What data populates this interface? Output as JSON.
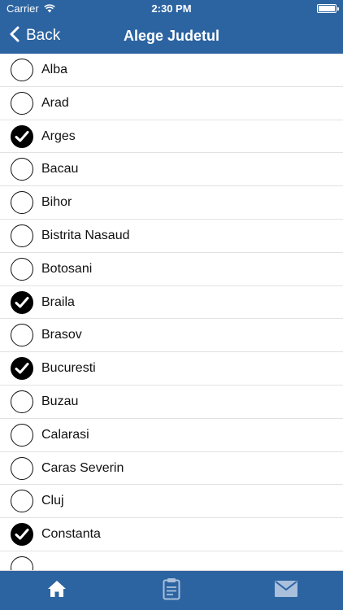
{
  "status_bar": {
    "carrier": "Carrier",
    "time": "2:30 PM"
  },
  "nav": {
    "back_label": "Back",
    "title": "Alege Judetul"
  },
  "counties": [
    {
      "label": "Alba",
      "checked": false
    },
    {
      "label": "Arad",
      "checked": false
    },
    {
      "label": "Arges",
      "checked": true
    },
    {
      "label": "Bacau",
      "checked": false
    },
    {
      "label": "Bihor",
      "checked": false
    },
    {
      "label": "Bistrita Nasaud",
      "checked": false
    },
    {
      "label": "Botosani",
      "checked": false
    },
    {
      "label": "Braila",
      "checked": true
    },
    {
      "label": "Brasov",
      "checked": false
    },
    {
      "label": "Bucuresti",
      "checked": true
    },
    {
      "label": "Buzau",
      "checked": false
    },
    {
      "label": "Calarasi",
      "checked": false
    },
    {
      "label": "Caras Severin",
      "checked": false
    },
    {
      "label": "Cluj",
      "checked": false
    },
    {
      "label": "Constanta",
      "checked": true
    },
    {
      "label": "",
      "checked": false
    }
  ],
  "tabs": [
    {
      "icon": "home-icon",
      "selected": true
    },
    {
      "icon": "clipboard-icon",
      "selected": false
    },
    {
      "icon": "mail-icon",
      "selected": false
    }
  ],
  "colors": {
    "brand": "#2c64a1",
    "tab_selected": "#ffffff",
    "tab_unselected": "#a9bfdc"
  }
}
